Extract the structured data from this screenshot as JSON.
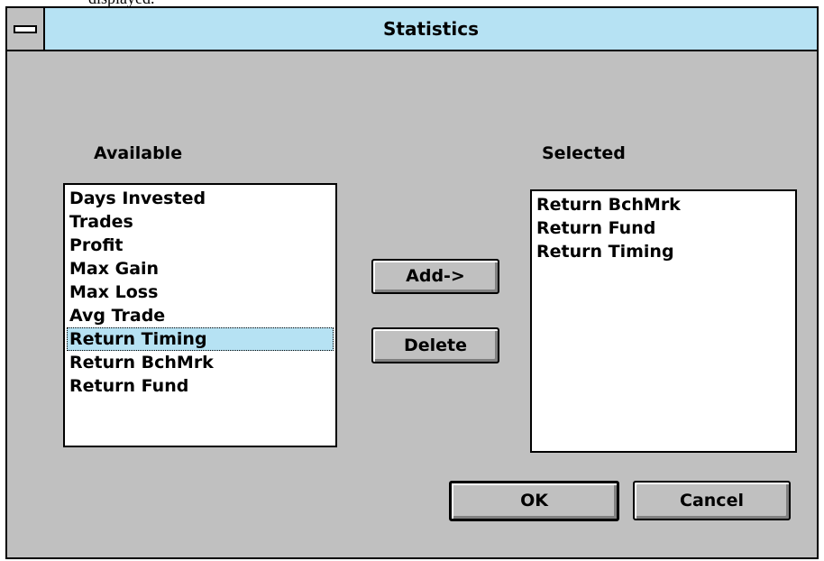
{
  "background_text": "displayed.",
  "window": {
    "title": "Statistics",
    "system_menu": "system-menu-icon"
  },
  "available": {
    "label": "Available",
    "items": [
      {
        "label": "Days Invested",
        "selected": false
      },
      {
        "label": "Trades",
        "selected": false
      },
      {
        "label": "Profit",
        "selected": false
      },
      {
        "label": "Max Gain",
        "selected": false
      },
      {
        "label": "Max Loss",
        "selected": false
      },
      {
        "label": "Avg Trade",
        "selected": false
      },
      {
        "label": "Return Timing",
        "selected": true
      },
      {
        "label": "Return BchMrk",
        "selected": false
      },
      {
        "label": "Return Fund",
        "selected": false
      }
    ]
  },
  "selected": {
    "label": "Selected",
    "items": [
      {
        "label": "Return BchMrk"
      },
      {
        "label": "Return Fund"
      },
      {
        "label": "Return Timing"
      }
    ]
  },
  "buttons": {
    "add": "Add->",
    "delete": "Delete",
    "ok": "OK",
    "cancel": "Cancel"
  },
  "colors": {
    "titlebar": "#b6e2f3",
    "highlight": "#b6e2f3",
    "face": "#c0c0c0"
  }
}
